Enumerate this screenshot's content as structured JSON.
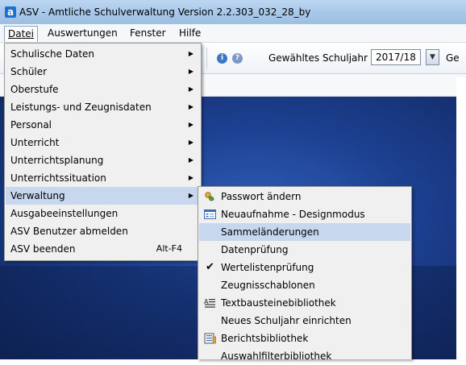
{
  "window": {
    "title": "ASV - Amtliche Schulverwaltung Version 2.2.303_032_28_by",
    "icon_letter": "a"
  },
  "menubar": {
    "items": [
      {
        "label": "Datei",
        "mnemonic": "D",
        "active": true
      },
      {
        "label": "Auswertungen",
        "mnemonic": "A"
      },
      {
        "label": "Fenster",
        "mnemonic": "F"
      },
      {
        "label": "Hilfe",
        "mnemonic": "H"
      }
    ]
  },
  "toolbar": {
    "schoolyear_label": "Gewähltes Schuljahr",
    "schoolyear_value": "2017/18",
    "cut_label": "Ge",
    "icons": [
      "info-icon",
      "help-icon"
    ]
  },
  "file_menu": {
    "items": [
      {
        "label": "Schulische Daten",
        "submenu": true
      },
      {
        "label": "Schüler",
        "submenu": true
      },
      {
        "label": "Oberstufe",
        "submenu": true
      },
      {
        "label": "Leistungs- und Zeugnisdaten",
        "submenu": true
      },
      {
        "label": "Personal",
        "submenu": true
      },
      {
        "label": "Unterricht",
        "submenu": true
      },
      {
        "label": "Unterrichtsplanung",
        "submenu": true
      },
      {
        "label": "Unterrichtssituation",
        "submenu": true
      },
      {
        "label": "Verwaltung",
        "submenu": true,
        "highlighted": true
      },
      {
        "label": "Ausgabeeinstellungen"
      },
      {
        "label": "ASV Benutzer abmelden"
      },
      {
        "label": "ASV beenden",
        "accelerator": "Alt-F4"
      }
    ]
  },
  "verwaltung_submenu": {
    "items": [
      {
        "label": "Passwort ändern",
        "icon": "keys-icon"
      },
      {
        "label": "Neuaufnahme - Designmodus",
        "icon": "form-icon"
      },
      {
        "label": "Sammeländerungen",
        "highlighted": true
      },
      {
        "label": "Datenprüfung"
      },
      {
        "label": "Wertelistenprüfung",
        "checked": true
      },
      {
        "label": "Zeugnisschablonen"
      },
      {
        "label": "Textbausteinebibliothek",
        "icon": "text-block-icon"
      },
      {
        "label": "Neues Schuljahr einrichten"
      },
      {
        "label": "Berichtsbibliothek",
        "icon": "report-library-icon"
      },
      {
        "label": "Auswahlfilterbibliothek"
      }
    ]
  },
  "colors": {
    "menu_highlight": "#c6d7ee",
    "menu_background": "#f0f0f0",
    "desktop_blue": "#1c3f8f",
    "title_bar": "#a9c8ea"
  }
}
